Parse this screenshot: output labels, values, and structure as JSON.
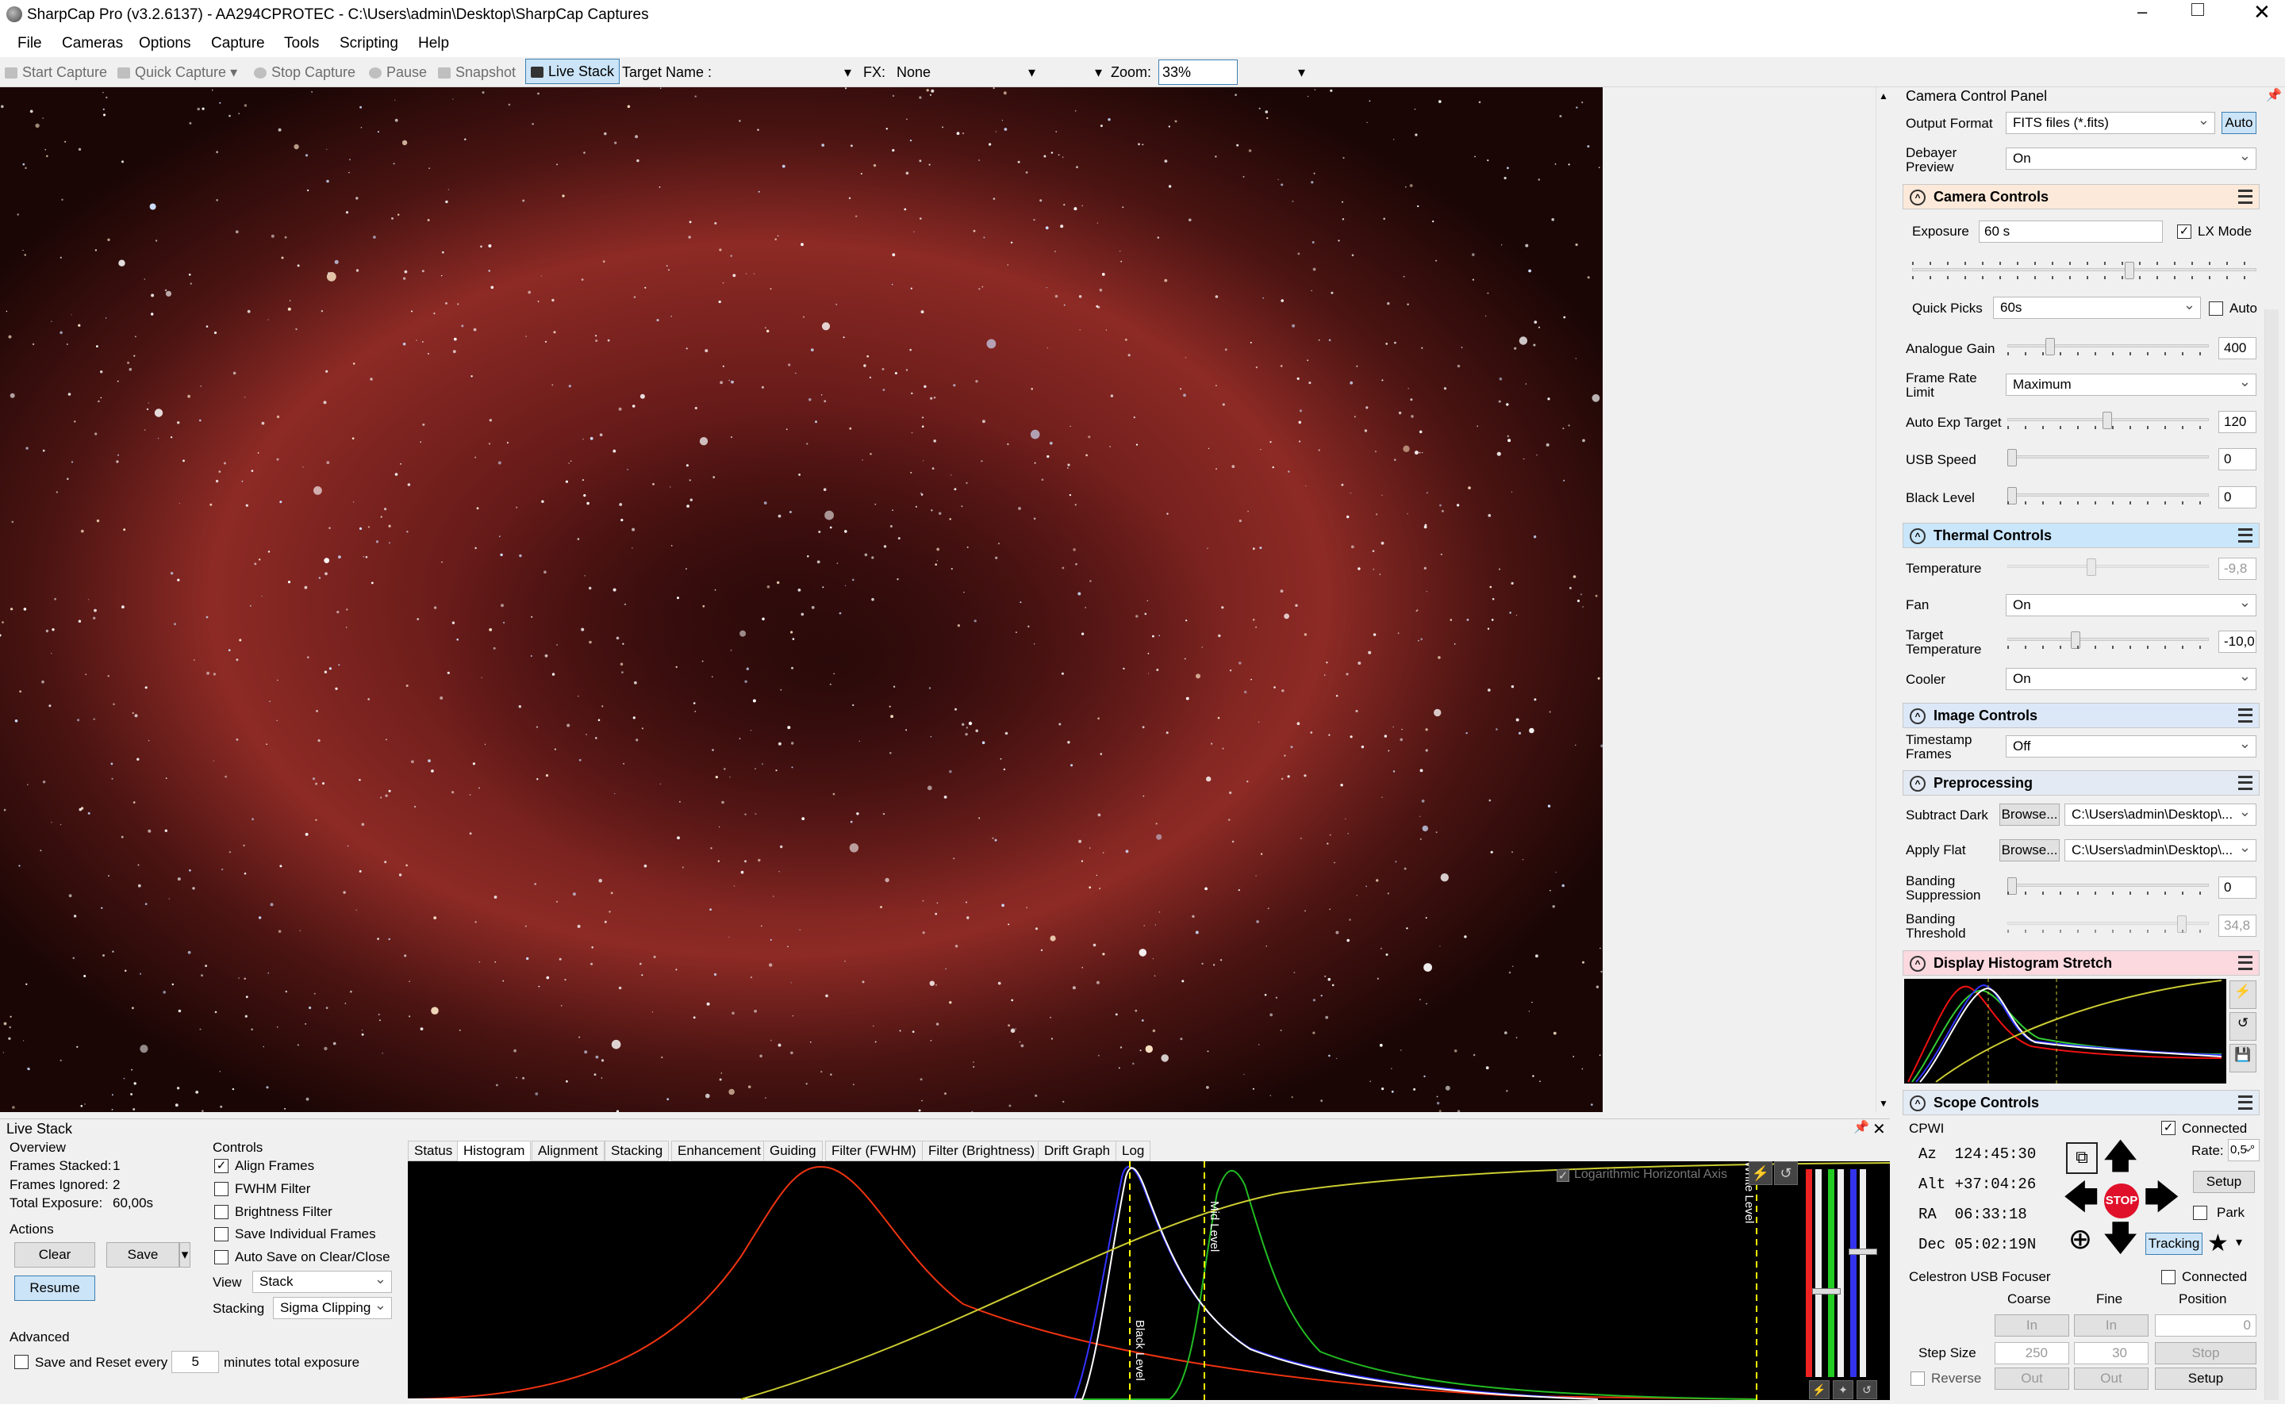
{
  "window": {
    "title": "SharpCap Pro (v3.2.6137) - AA294CPROTEC - C:\\Users\\admin\\Desktop\\SharpCap Captures"
  },
  "menu": [
    "File",
    "Cameras",
    "Options",
    "Capture",
    "Tools",
    "Scripting",
    "Help"
  ],
  "toolbar": {
    "start_capture": "Start Capture",
    "quick_capture": "Quick Capture",
    "stop_capture": "Stop Capture",
    "pause": "Pause",
    "snapshot": "Snapshot",
    "live_stack": "Live Stack",
    "target_name_label": "Target Name :",
    "target_name_value": "",
    "fx_label": "FX:",
    "fx_value": "None",
    "zoom_label": "Zoom:",
    "zoom_value": "33%"
  },
  "panel": {
    "title": "Camera Control Panel",
    "output_format_label": "Output Format",
    "output_format_value": "FITS files (*.fits)",
    "auto_button": "Auto",
    "debayer_label": "Debayer Preview",
    "debayer_value": "On",
    "camera_controls": {
      "header": "Camera Controls",
      "exposure_label": "Exposure",
      "exposure_value": "60 s",
      "lx_mode": "LX Mode",
      "quick_picks_label": "Quick Picks",
      "quick_picks_value": "60s",
      "auto_label": "Auto",
      "analogue_gain_label": "Analogue Gain",
      "analogue_gain_value": "400",
      "frame_rate_label": "Frame Rate Limit",
      "frame_rate_value": "Maximum",
      "auto_exp_label": "Auto Exp Target",
      "auto_exp_value": "120",
      "usb_speed_label": "USB Speed",
      "usb_speed_value": "0",
      "black_level_label": "Black Level",
      "black_level_value": "0"
    },
    "thermal_controls": {
      "header": "Thermal Controls",
      "temperature_label": "Temperature",
      "temperature_value": "-9,8",
      "fan_label": "Fan",
      "fan_value": "On",
      "target_temp_label": "Target Temperature",
      "target_temp_value": "-10,0",
      "cooler_label": "Cooler",
      "cooler_value": "On"
    },
    "image_controls": {
      "header": "Image Controls",
      "timestamp_label": "Timestamp Frames",
      "timestamp_value": "Off"
    },
    "preprocessing": {
      "header": "Preprocessing",
      "subtract_dark_label": "Subtract Dark",
      "browse": "Browse...",
      "subtract_dark_path": "C:\\Users\\admin\\Desktop\\...",
      "apply_flat_label": "Apply Flat",
      "apply_flat_path": "C:\\Users\\admin\\Desktop\\...",
      "banding_supp_label": "Banding Suppression",
      "banding_supp_value": "0",
      "banding_thresh_label": "Banding Threshold",
      "banding_thresh_value": "34,8"
    },
    "histogram_stretch": {
      "header": "Display Histogram Stretch"
    },
    "scope_controls": {
      "header": "Scope Controls",
      "mount": "CPWI",
      "connected": "Connected",
      "az": "Az  124:45:30",
      "alt": "Alt +37:04:26",
      "ra": "RA  06:33:18",
      "dec": "Dec 05:02:19N",
      "rate_label": "Rate:",
      "rate_value": "0,5 °",
      "setup": "Setup",
      "stop": "STOP",
      "park": "Park",
      "tracking": "Tracking"
    },
    "focuser": {
      "name": "Celestron USB Focuser",
      "connected": "Connected",
      "coarse": "Coarse",
      "fine": "Fine",
      "position": "Position",
      "in": "In",
      "out": "Out",
      "position_value": "0",
      "step_size_label": "Step Size",
      "coarse_value": "250",
      "fine_value": "30",
      "stop": "Stop",
      "reverse": "Reverse",
      "setup": "Setup"
    }
  },
  "live_stack": {
    "title": "Live Stack",
    "overview": "Overview",
    "frames_stacked_label": "Frames Stacked:",
    "frames_stacked": "1",
    "frames_ignored_label": "Frames Ignored:",
    "frames_ignored": "2",
    "total_exposure_label": "Total Exposure:",
    "total_exposure": "60,00s",
    "actions": "Actions",
    "clear": "Clear",
    "save": "Save",
    "resume": "Resume",
    "advanced": "Advanced",
    "save_reset": "Save and Reset every",
    "save_reset_value": "5",
    "minutes": "minutes total exposure",
    "controls": "Controls",
    "align_frames": "Align Frames",
    "fwhm_filter": "FWHM Filter",
    "brightness_filter": "Brightness Filter",
    "save_individual": "Save Individual Frames",
    "auto_save": "Auto Save on Clear/Close",
    "view_label": "View",
    "view_value": "Stack",
    "stacking_label": "Stacking",
    "stacking_value": "Sigma Clipping",
    "tabs": [
      "Status",
      "Histogram",
      "Alignment",
      "Stacking",
      "Enhancement",
      "Guiding",
      "Filter (FWHM)",
      "Filter (Brightness)",
      "Drift Graph",
      "Log"
    ],
    "log_axis": "Logarithmic Horizontal Axis",
    "black_level": "Black Level",
    "mid_level": "Mid Level",
    "white_level": "White Level"
  },
  "colors": {
    "accent_blue": "#cce4f7",
    "camera_hdr": "#fde9d9",
    "thermal_hdr": "#c9e6fb",
    "image_hdr": "#dce8f8",
    "pre_hdr": "#e3eaf3",
    "disp_hdr": "#fbd9df",
    "scope_hdr": "#e3ebf5",
    "stop_red": "#e0102a"
  }
}
